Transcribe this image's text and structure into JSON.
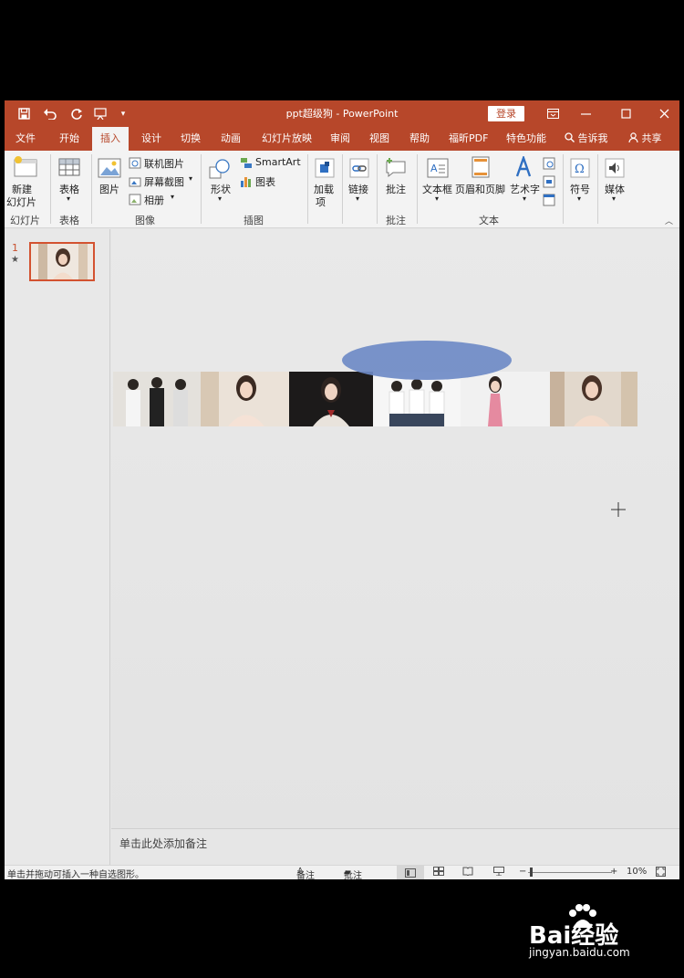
{
  "window": {
    "title": "ppt超级狗 - PowerPoint",
    "login_label": "登录",
    "restore_icon": "ribbon-display-icon",
    "min_icon": "minimize-icon",
    "max_icon": "maximize-icon",
    "close_icon": "close-icon"
  },
  "quick_access": {
    "save": "save-icon",
    "undo": "undo-icon",
    "redo": "redo-icon",
    "present": "present-icon",
    "customize": "customize-icon"
  },
  "tabs": [
    "文件",
    "开始",
    "插入",
    "设计",
    "切换",
    "动画",
    "幻灯片放映",
    "审阅",
    "视图",
    "帮助",
    "福昕PDF",
    "特色功能"
  ],
  "active_tab": "插入",
  "tell_me": "告诉我",
  "share": "共享",
  "ribbon": {
    "new_slide_1": "新建",
    "new_slide_2": "幻灯片",
    "table": "表格",
    "picture": "图片",
    "online_picture": "联机图片",
    "screenshot": "屏幕截图",
    "album": "相册",
    "shapes": "形状",
    "smartart": "SmartArt",
    "chart": "图表",
    "addins_1": "加载",
    "addins_2": "项",
    "link": "链接",
    "comment": "批注",
    "textbox": "文本框",
    "header_footer": "页眉和页脚",
    "wordart": "艺术字",
    "symbol": "符号",
    "media": "媒体",
    "groups": {
      "slides": "幻灯片",
      "tables": "表格",
      "images": "图像",
      "illustrations": "插图",
      "comments": "批注",
      "text": "文本"
    }
  },
  "thumbnail": {
    "number": "1",
    "star": "★"
  },
  "notes_placeholder": "单击此处添加备注",
  "status": {
    "hint": "单击并拖动可插入一种自选图形。",
    "notes": "备注",
    "comments": "批注",
    "zoom": "10%"
  },
  "watermark": {
    "brand": "Bai经验",
    "url": "jingyan.baidu.com"
  },
  "colors": {
    "accent": "#b7472a",
    "oval": "#6e8ac6"
  }
}
